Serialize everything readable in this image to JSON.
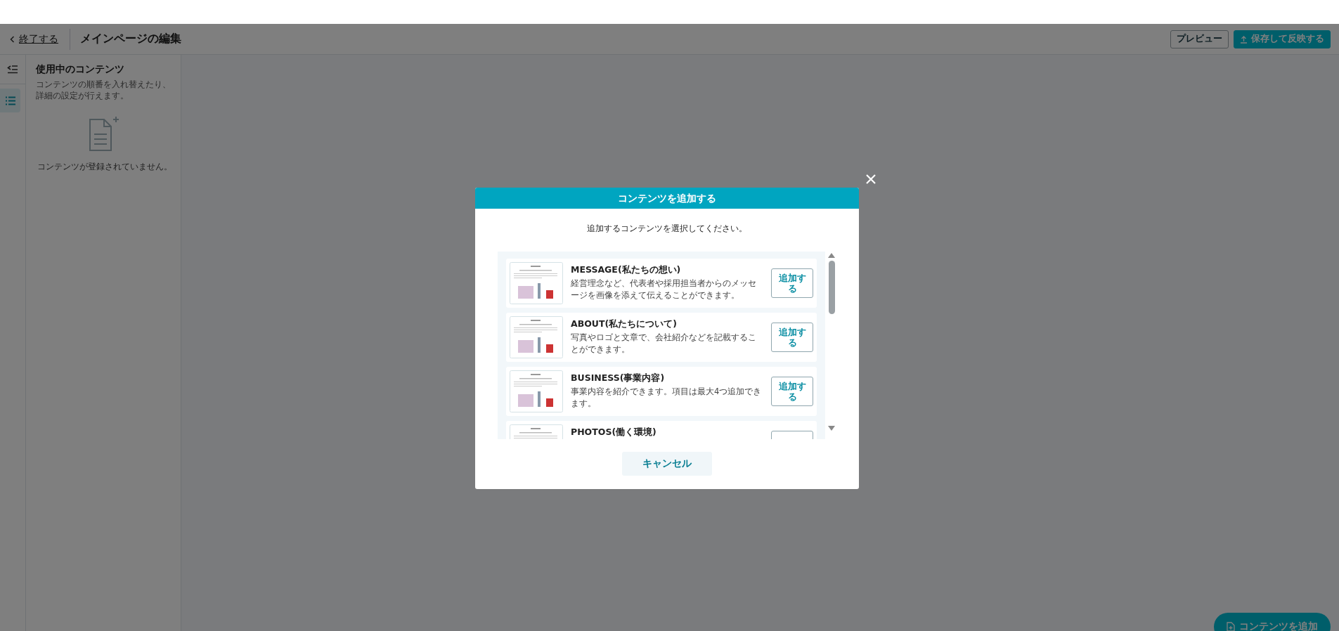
{
  "header": {
    "back_link": "終了する",
    "title": "メインページの編集",
    "buttons": [
      {
        "label": "プレビュー",
        "kind": "outline"
      },
      {
        "label": "保存して反映する",
        "kind": "primary"
      }
    ]
  },
  "side_tabs": [
    {
      "kind": "collapse",
      "selected": false
    },
    {
      "kind": "list",
      "selected": true
    }
  ],
  "panel": {
    "title": "使用中のコンテンツ",
    "description": "コンテンツの順番を入れ替えたり、詳細の設定が行えます。",
    "empty_message": "コンテンツが登録されていません。"
  },
  "modal": {
    "title": "コンテンツを追加する",
    "instruction": "追加するコンテンツを選択してください。",
    "items": [
      {
        "name": "MESSAGE(私たちの想い)",
        "description": "経営理念など、代表者や採用担当者からのメッセージを画像を添えて伝えることができます。",
        "button": "追加する"
      },
      {
        "name": "ABOUT(私たちについて)",
        "description": "写真やロゴと文章で、会社紹介などを記載することができます。",
        "button": "追加する"
      },
      {
        "name": "BUSINESS(事業内容)",
        "description": "事業内容を紹介できます。項目は最大4つ追加できます。",
        "button": "追加する"
      },
      {
        "name": "PHOTOS(働く環境)"
      }
    ],
    "cancel": "キャンセル"
  },
  "fab": {
    "label": "コンテンツを追加"
  }
}
